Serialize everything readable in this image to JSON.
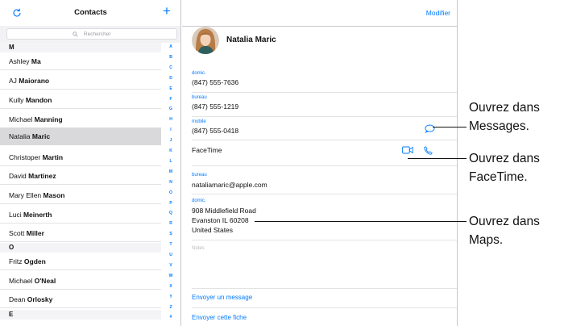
{
  "left": {
    "title": "Contacts",
    "add_label": "+",
    "search_placeholder": "Rechercher",
    "sections": [
      {
        "letter": "M",
        "contacts": [
          {
            "first": "Ashley",
            "last": "Ma"
          },
          {
            "first": "AJ",
            "last": "Maiorano"
          },
          {
            "first": "Kully",
            "last": "Mandon"
          },
          {
            "first": "Michael",
            "last": "Manning"
          },
          {
            "first": "Natalia",
            "last": "Maric",
            "selected": true
          },
          {
            "first": "Christoper",
            "last": "Martin"
          },
          {
            "first": "David",
            "last": "Martinez"
          },
          {
            "first": "Mary Ellen",
            "last": "Mason"
          },
          {
            "first": "Luci",
            "last": "Meinerth"
          },
          {
            "first": "Scott",
            "last": "Miller"
          }
        ]
      },
      {
        "letter": "O",
        "contacts": [
          {
            "first": "Fritz",
            "last": "Ogden"
          },
          {
            "first": "Michael",
            "last": "O'Neal"
          },
          {
            "first": "Dean",
            "last": "Orlosky"
          }
        ]
      },
      {
        "letter": "E",
        "contacts": []
      }
    ],
    "index": [
      "A",
      "B",
      "C",
      "D",
      "E",
      "F",
      "G",
      "H",
      "I",
      "J",
      "K",
      "L",
      "M",
      "N",
      "O",
      "P",
      "Q",
      "R",
      "S",
      "T",
      "U",
      "V",
      "W",
      "X",
      "Y",
      "Z",
      "#"
    ]
  },
  "detail": {
    "edit_label": "Modifier",
    "name": "Natalia Maric",
    "phones": [
      {
        "label": "domic.",
        "value": "(847) 555-7636"
      },
      {
        "label": "bureau",
        "value": "(847) 555-1219"
      },
      {
        "label": "mobile",
        "value": "(847) 555-0418"
      }
    ],
    "facetime_label": "FaceTime",
    "email": {
      "label": "bureau",
      "value": "nataliamaric@apple.com"
    },
    "address": {
      "label": "domic.",
      "line1": "908 Middlefield Road",
      "line2": "Evanston IL 60208",
      "line3": "United States"
    },
    "notes_label": "Notes",
    "send_message": "Envoyer un message",
    "share_contact": "Envoyer cette fiche",
    "accent_color": "#007aff"
  },
  "callouts": [
    {
      "text": "Ouvrez dans\nMessages."
    },
    {
      "text": "Ouvrez dans\nFaceTime."
    },
    {
      "text": "Ouvrez dans\nMaps."
    }
  ]
}
